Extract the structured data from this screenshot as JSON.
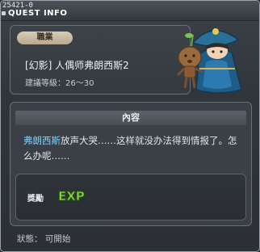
{
  "window": {
    "quest_id": "25421-0",
    "title": "QUEST INFO"
  },
  "header": {
    "job_label": "職業",
    "quest_name": "[幻影] 人偶师弗朗西斯2",
    "recommended_level": "建議等級：26～30"
  },
  "content": {
    "heading": "內容",
    "npc_name": "弗朗西斯",
    "dialogue_rest": "放声大哭……这样就没办法得到情报了。怎么办呢……"
  },
  "reward": {
    "label": "獎勵",
    "exp_text": "EXP"
  },
  "status": {
    "text": "狀態： 可開始"
  },
  "colors": {
    "npc_name": "#7ed3ff",
    "exp_green": "#8ee63c",
    "job_tag": "#c8bba3"
  }
}
